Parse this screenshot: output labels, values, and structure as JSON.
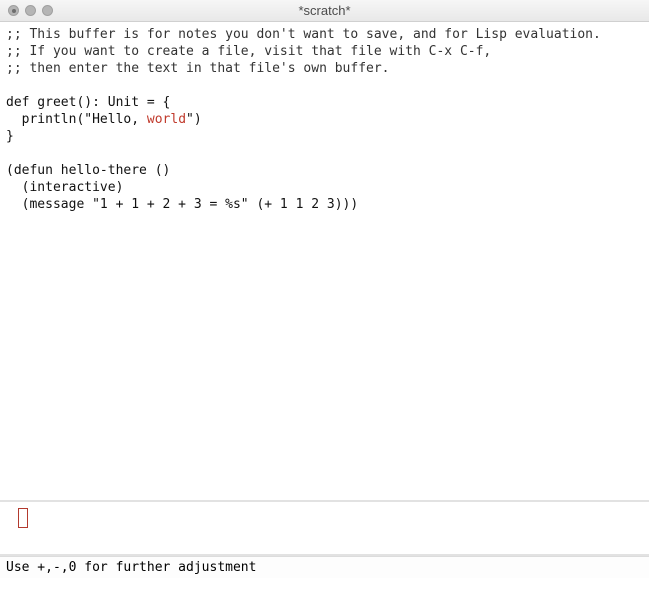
{
  "window": {
    "title": "*scratch*"
  },
  "buffer": {
    "lines": [
      {
        "kind": "comment",
        "text": ";; This buffer is for notes you don't want to save, and for Lisp evaluation."
      },
      {
        "kind": "comment",
        "text": ";; If you want to create a file, visit that file with C-x C-f,"
      },
      {
        "kind": "comment",
        "text": ";; then enter the text in that file's own buffer."
      },
      {
        "kind": "blank",
        "text": ""
      },
      {
        "kind": "code",
        "text": "def greet(): Unit = {"
      },
      {
        "kind": "code-err",
        "prefix": "  println(\"Hello, ",
        "err": "world",
        "suffix": "\")"
      },
      {
        "kind": "code",
        "text": "}"
      },
      {
        "kind": "blank",
        "text": ""
      },
      {
        "kind": "code",
        "text": "(defun hello-there ()"
      },
      {
        "kind": "code",
        "text": "  (interactive)"
      },
      {
        "kind": "code",
        "text": "  (message \"1 + 1 + 2 + 3 = %s\" (+ 1 1 2 3)))"
      }
    ]
  },
  "echo": {
    "message": "Use +,-,0 for further adjustment"
  }
}
